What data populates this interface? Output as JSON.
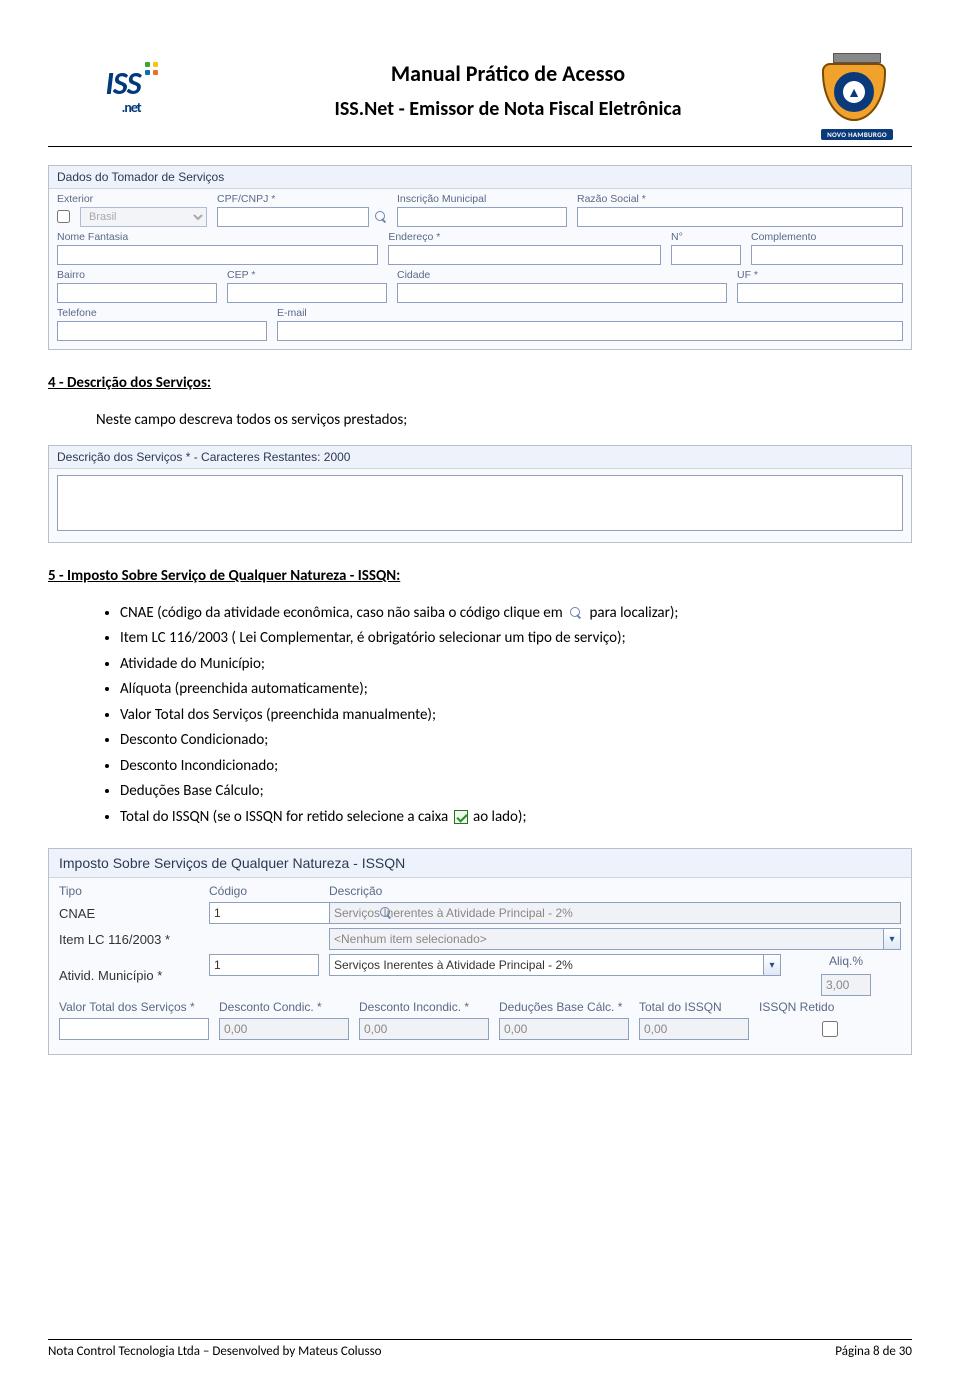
{
  "header": {
    "title": "Manual Prático de Acesso",
    "subtitle": "ISS.Net -  Emissor de Nota Fiscal Eletrônica",
    "logo_text": "ISS",
    "logo_sub": ".net",
    "ribbon": "NOVO HAMBURGO"
  },
  "tomador": {
    "section_title": "Dados do Tomador de Serviços",
    "labels": {
      "exterior": "Exterior",
      "cpfcnpj": "CPF/CNPJ *",
      "inscmun": "Inscrição Municipal",
      "razao": "Razão Social *",
      "nomefant": "Nome Fantasia",
      "endereco": "Endereço *",
      "numero": "N°",
      "complemento": "Complemento",
      "bairro": "Bairro",
      "cep": "CEP *",
      "cidade": "Cidade",
      "uf": "UF *",
      "telefone": "Telefone",
      "email": "E-mail"
    },
    "values": {
      "brasil": "Brasil"
    }
  },
  "sec4": {
    "heading": "4 - Descrição dos Serviços:",
    "lead": "Neste campo descreva todos os serviços prestados;",
    "panel_title": "Descrição dos Serviços * - Caracteres Restantes: 2000"
  },
  "sec5": {
    "heading": "5 - Imposto Sobre Serviço de Qualquer Natureza - ISSQN:",
    "bullets": {
      "b1a": "CNAE (código da atividade econômica, caso não saiba o código clique em ",
      "b1b": " para localizar);",
      "b2": "Item LC 116/2003 ( Lei Complementar, é obrigatório selecionar um tipo de serviço);",
      "b3": "Atividade do Município;",
      "b4": "Alíquota (preenchida automaticamente);",
      "b5": "Valor Total dos Serviços (preenchida manualmente);",
      "b6": "Desconto Condicionado;",
      "b7": "Desconto Incondicionado;",
      "b8": "Deduções Base Cálculo;",
      "b9a": "Total do ISSQN (se o ISSQN for retido selecione a caixa ",
      "b9b": "ao lado);"
    }
  },
  "issqn": {
    "section_title": "Imposto Sobre Serviços de Qualquer Natureza - ISSQN",
    "labels": {
      "tipo": "Tipo",
      "codigo": "Código",
      "descricao": "Descrição",
      "cnae": "CNAE",
      "item": "Item LC 116/2003 *",
      "ativ": "Ativid. Município *",
      "aliq": "Aliq.%",
      "valortotal": "Valor Total dos Serviços *",
      "desccond": "Desconto Condic. *",
      "descincond": "Desconto Incondic. *",
      "dedbase": "Deduções Base Cálc. *",
      "totalissqn": "Total do ISSQN",
      "retido": "ISSQN Retido"
    },
    "values": {
      "cnae_cod": "1",
      "cnae_desc": "Serviços Inerentes à Atividade Principal - 2%",
      "item_desc": "<Nenhum item selecionado>",
      "ativ_cod": "1",
      "ativ_desc": "Serviços Inerentes à Atividade Principal - 2%",
      "aliq": "3,00",
      "valortotal": "",
      "desccond": "0,00",
      "descincond": "0,00",
      "dedbase": "0,00",
      "totalissqn": "0,00"
    }
  },
  "footer": {
    "left": "Nota Control Tecnologia Ltda – Desenvolved by Mateus Colusso",
    "right": "Página 8 de 30"
  }
}
